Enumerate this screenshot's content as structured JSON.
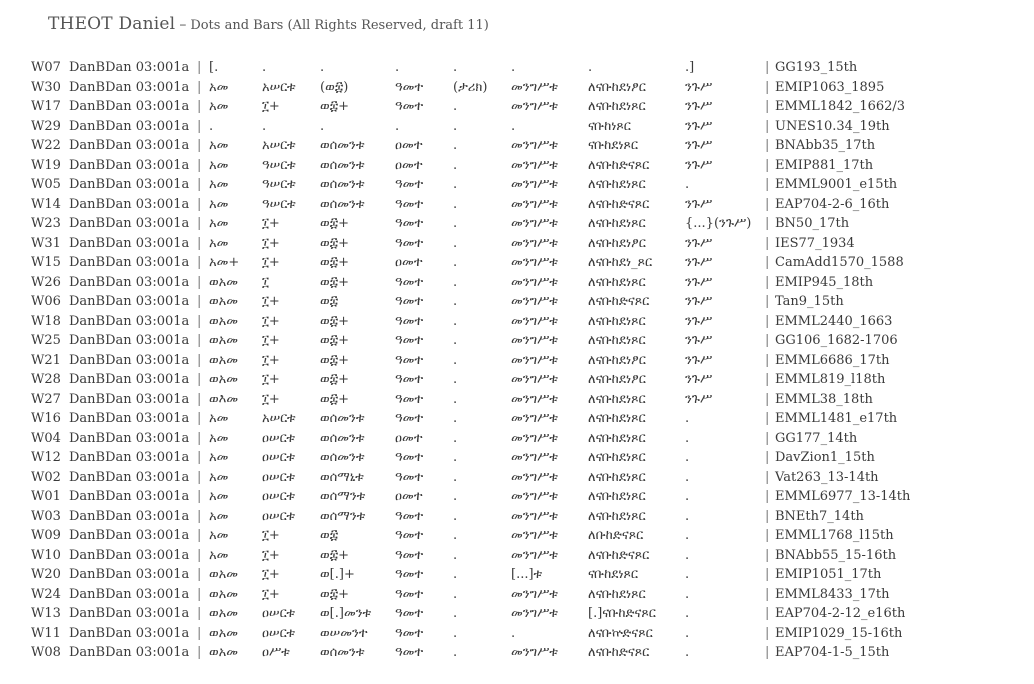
{
  "header": {
    "author": "THEOT Daniel",
    "dash": "–",
    "subtitle": "Dots and Bars (All Rights Reserved, draft 11)"
  },
  "separator": "|",
  "rows": [
    {
      "id": "W07",
      "ref": "DanBDan 03:001a",
      "cols": [
        "[.",
        ".",
        ".",
        ".",
        ".",
        ".",
        ".",
        ".]"
      ],
      "ms": "GG193_15th"
    },
    {
      "id": "W30",
      "ref": "DanBDan 03:001a",
      "cols": [
        "አመ",
        "አሠርቱ",
        "(ወ፰)",
        "ዓመተ",
        "(ታሪክ)",
        "መንግሥቱ",
        "ለናቡከደነፆር",
        "ንጉሥ"
      ],
      "ms": "EMIP1063_1895"
    },
    {
      "id": "W17",
      "ref": "DanBDan 03:001a",
      "cols": [
        "አመ",
        "፲+",
        "ወ፰+",
        "ዓመተ",
        ".",
        "መንግሥቱ",
        "ለናቡከደነጾር",
        "ንጉሥ"
      ],
      "ms": "EMML1842_1662/3"
    },
    {
      "id": "W29",
      "ref": "DanBDan 03:001a",
      "cols": [
        ".",
        ".",
        ".",
        ".",
        ".",
        ".",
        "ናቡከነጾር",
        "ንጉሥ"
      ],
      "ms": "UNES10.34_19th"
    },
    {
      "id": "W22",
      "ref": "DanBDan 03:001a",
      "cols": [
        "አመ",
        "አሠርቱ",
        "ወሰመንቱ",
        "ዐመተ",
        ".",
        "መንግሥቱ",
        "ናቡከደነጾር",
        "ንጉሥ"
      ],
      "ms": "BNAbb35_17th"
    },
    {
      "id": "W19",
      "ref": "DanBDan 03:001a",
      "cols": [
        "አመ",
        "ዓሠርቱ",
        "ወሰመንቱ",
        "ዐመተ",
        ".",
        "መንግሥቱ",
        "ለናቡከድናጾር",
        "ንጉሥ"
      ],
      "ms": "EMIP881_17th"
    },
    {
      "id": "W05",
      "ref": "DanBDan 03:001a",
      "cols": [
        "አመ",
        "ዓሠርቱ",
        "ወሰመንቱ",
        "ዓመተ",
        ".",
        "መንግሥቱ",
        "ለናቡከደነጾር",
        "."
      ],
      "ms": "EMML9001_e15th"
    },
    {
      "id": "W14",
      "ref": "DanBDan 03:001a",
      "cols": [
        "አመ",
        "ዓሠርቱ",
        "ወሰመንቱ",
        "ዓመተ",
        ".",
        "መንግሥቱ",
        "ለናቡከድናጾር",
        "ንጉሥ"
      ],
      "ms": "EAP704-2-6_16th"
    },
    {
      "id": "W23",
      "ref": "DanBDan 03:001a",
      "cols": [
        "አመ",
        "፲+",
        "ወ፰+",
        "ዓመተ",
        ".",
        "መንግሥቱ",
        "ለናቡከደነጾር",
        "{...}(ንጉሥ)"
      ],
      "ms": "BN50_17th"
    },
    {
      "id": "W31",
      "ref": "DanBDan 03:001a",
      "cols": [
        "አመ",
        "፲+",
        "ወ፰+",
        "ዓመተ",
        ".",
        "መንግሥቱ",
        "ለናቡከደነፆር",
        "ንጉሥ"
      ],
      "ms": "IES77_1934"
    },
    {
      "id": "W15",
      "ref": "DanBDan 03:001a",
      "cols": [
        "አመ+",
        "፲+",
        "ወ፰+",
        "ዐመተ",
        ".",
        "መንግሥቱ",
        "ለናቡከደነ_ጾር",
        "ንጉሥ"
      ],
      "ms": "CamAdd1570_1588"
    },
    {
      "id": "W26",
      "ref": "DanBDan 03:001a",
      "cols": [
        "ወአመ",
        "፲",
        "ወ፰+",
        "ዓመተ",
        ".",
        "መንግሥቱ",
        "ለናቡከደነጾር",
        "ንጉሥ"
      ],
      "ms": "EMIP945_18th"
    },
    {
      "id": "W06",
      "ref": "DanBDan 03:001a",
      "cols": [
        "ወአመ",
        "፲+",
        "ወ፰",
        "ዓመተ",
        ".",
        "መንግሥቱ",
        "ለናቡከድናጾር",
        "ንጉሥ"
      ],
      "ms": "Tan9_15th"
    },
    {
      "id": "W18",
      "ref": "DanBDan 03:001a",
      "cols": [
        "ወአመ",
        "፲+",
        "ወ፰+",
        "ዓመተ",
        ".",
        "መንግሥቱ",
        "ለናቡከደነጾር",
        "ንጉሥ"
      ],
      "ms": "EMML2440_1663"
    },
    {
      "id": "W25",
      "ref": "DanBDan 03:001a",
      "cols": [
        "ወአመ",
        "፲+",
        "ወ፰+",
        "ዓመተ",
        ".",
        "መንግሥቱ",
        "ለናቡከደነጾር",
        "ንጉሥ"
      ],
      "ms": "GG106_1682-1706"
    },
    {
      "id": "W21",
      "ref": "DanBDan 03:001a",
      "cols": [
        "ወአመ",
        "፲+",
        "ወ፰+",
        "ዓመተ",
        ".",
        "መንግሥቱ",
        "ለናቡከደነፆር",
        "ንጉሥ"
      ],
      "ms": "EMML6686_17th"
    },
    {
      "id": "W28",
      "ref": "DanBDan 03:001a",
      "cols": [
        "ወአመ",
        "፲+",
        "ወ፰+",
        "ዓመተ",
        ".",
        "መንግሥቱ",
        "ለናቡከደነፆር",
        "ንጉሥ"
      ],
      "ms": "EMML819_l18th"
    },
    {
      "id": "W27",
      "ref": "DanBDan 03:001a",
      "cols": [
        "ወእመ",
        "፲+",
        "ወ፰+",
        "ዓመተ",
        ".",
        "መንግሥቱ",
        "ለናቡከደነጾር",
        "ንጉሥ"
      ],
      "ms": "EMML38_18th"
    },
    {
      "id": "W16",
      "ref": "DanBDan 03:001a",
      "cols": [
        "አመ",
        "አሠርቱ",
        "ወሰመንቱ",
        "ዓመተ",
        ".",
        "መንግሥቱ",
        "ለናቡከደነጾር",
        "."
      ],
      "ms": "EMML1481_e17th"
    },
    {
      "id": "W04",
      "ref": "DanBDan 03:001a",
      "cols": [
        "አመ",
        "ዐሠርቱ",
        "ወሰመንቱ",
        "ዐመተ",
        ".",
        "መንግሥቱ",
        "ለናቡከደነጾር",
        "."
      ],
      "ms": "GG177_14th"
    },
    {
      "id": "W12",
      "ref": "DanBDan 03:001a",
      "cols": [
        "አመ",
        "ዐሠርቱ",
        "ወሰመንቱ",
        "ዓመተ",
        ".",
        "መንግሥቱ",
        "ለናቡከደነጾር",
        "."
      ],
      "ms": "DavZion1_15th"
    },
    {
      "id": "W02",
      "ref": "DanBDan 03:001a",
      "cols": [
        "አመ",
        "ዐሠርቱ",
        "ወሰማኒቱ",
        "ዓመተ",
        ".",
        "መንግሥቱ",
        "ለናቡከደነጾር",
        "."
      ],
      "ms": "Vat263_13-14th"
    },
    {
      "id": "W01",
      "ref": "DanBDan 03:001a",
      "cols": [
        "አመ",
        "ዐሠርቱ",
        "ወሰማንቱ",
        "ዐመተ",
        ".",
        "መንግሥቱ",
        "ለናቡከደነጾር",
        "."
      ],
      "ms": "EMML6977_13-14th"
    },
    {
      "id": "W03",
      "ref": "DanBDan 03:001a",
      "cols": [
        "አመ",
        "ዐሠርቱ",
        "ወሰማንቱ",
        "ዓመተ",
        ".",
        "መንግሥቱ",
        "ለናቡከደነጾር",
        "."
      ],
      "ms": "BNEth7_14th"
    },
    {
      "id": "W09",
      "ref": "DanBDan 03:001a",
      "cols": [
        "አመ",
        "፲+",
        "ወ፰",
        "ዓመተ",
        ".",
        "መንግሥቱ",
        "ለቡከድናጾር",
        "."
      ],
      "ms": "EMML1768_l15th"
    },
    {
      "id": "W10",
      "ref": "DanBDan 03:001a",
      "cols": [
        "አመ",
        "፲+",
        "ወ፰+",
        "ዓመተ",
        ".",
        "መንግሥቱ",
        "ለናቡከድናጾር",
        "."
      ],
      "ms": "BNAbb55_15-16th"
    },
    {
      "id": "W20",
      "ref": "DanBDan 03:001a",
      "cols": [
        "ወአመ",
        "፲+",
        "ወ[.]+",
        "ዓመተ",
        ".",
        "[...]ቱ",
        "ናቡከደነጾር",
        "."
      ],
      "ms": "EMIP1051_17th"
    },
    {
      "id": "W24",
      "ref": "DanBDan 03:001a",
      "cols": [
        "ወአመ",
        "፲+",
        "ወ፰+",
        "ዓመተ",
        ".",
        "መንግሥቱ",
        "ለናቡከደነጾር",
        "."
      ],
      "ms": "EMML8433_17th"
    },
    {
      "id": "W13",
      "ref": "DanBDan 03:001a",
      "cols": [
        "ወአመ",
        "ዐሠርቱ",
        "ወ[.]መንቱ",
        "ዓመተ",
        ".",
        "መንግሥቱ",
        "[.]ናቡከድናጾር",
        "."
      ],
      "ms": "EAP704-2-12_e16th"
    },
    {
      "id": "W11",
      "ref": "DanBDan 03:001a",
      "cols": [
        "ወአመ",
        "ዐሠርቱ",
        "ወሠመንተ",
        "ዓመተ",
        ".",
        ".",
        "ለናቡኵድናጾር",
        "."
      ],
      "ms": "EMIP1029_15-16th"
    },
    {
      "id": "W08",
      "ref": "DanBDan 03:001a",
      "cols": [
        "ወአመ",
        "ዐሥቱ",
        "ወሰመንቱ",
        "ዓመተ",
        ".",
        "መንግሥቱ",
        "ለናቡከድናጾር",
        "."
      ],
      "ms": "EAP704-1-5_15th"
    }
  ]
}
